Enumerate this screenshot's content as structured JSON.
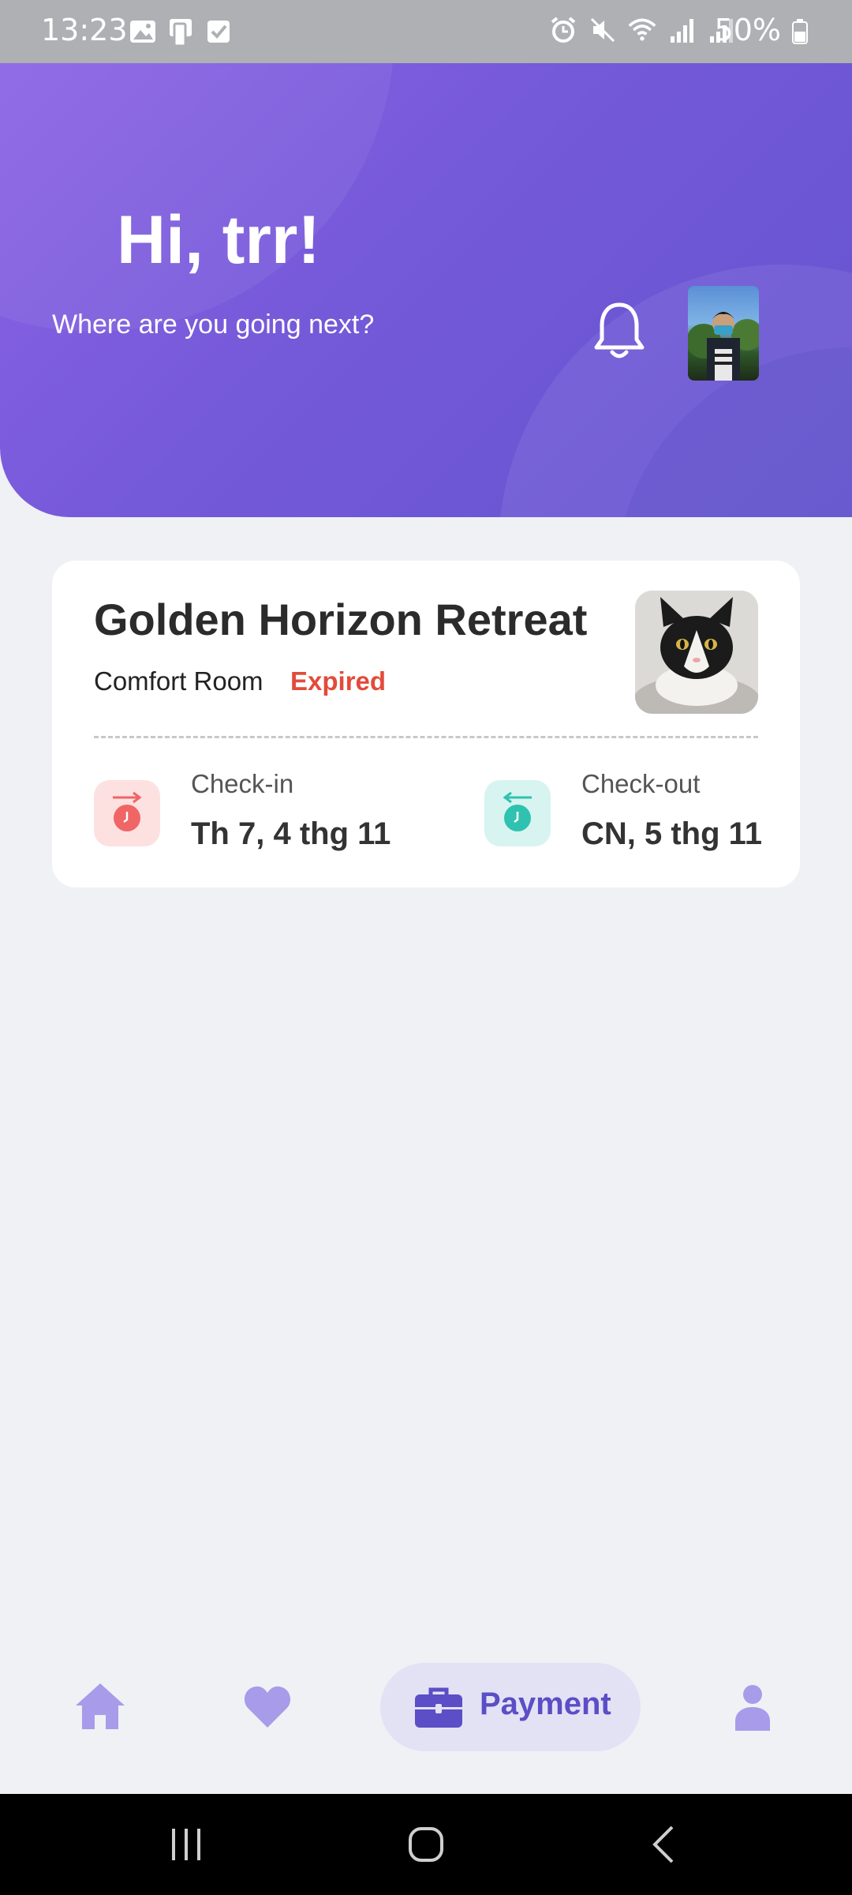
{
  "status_bar": {
    "time": "13:23",
    "battery": "50%"
  },
  "header": {
    "greeting": "Hi, trr!",
    "subtitle": "Where are you going next?"
  },
  "booking": {
    "hotel_name": "Golden Horizon Retreat",
    "room_type": "Comfort Room",
    "status": "Expired",
    "check_in_label": "Check-in",
    "check_in_date": "Th 7, 4 thg 11",
    "check_out_label": "Check-out",
    "check_out_date": "CN, 5 thg 11"
  },
  "bottom_nav": {
    "active_label": "Payment",
    "items": [
      "home-icon",
      "heart-icon",
      "briefcase-icon",
      "person-icon"
    ]
  },
  "colors": {
    "accent": "#6c5bd4",
    "status_expired": "#e24b3b",
    "checkin": "#f06565",
    "checkout": "#2fc2b0"
  }
}
